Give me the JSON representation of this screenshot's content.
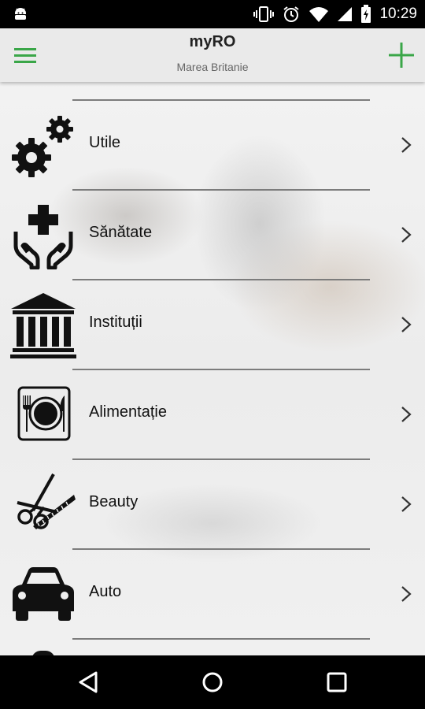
{
  "status_bar": {
    "time": "10:29"
  },
  "app_bar": {
    "title": "myRO",
    "subtitle": "Marea Britanie",
    "accent_color": "#3aa648"
  },
  "categories": [
    {
      "label": "Utile",
      "icon": "gears-icon"
    },
    {
      "label": "Sănătate",
      "icon": "health-hands-icon"
    },
    {
      "label": "Instituții",
      "icon": "institution-icon"
    },
    {
      "label": "Alimentație",
      "icon": "plate-cutlery-icon"
    },
    {
      "label": "Beauty",
      "icon": "scissors-comb-icon"
    },
    {
      "label": "Auto",
      "icon": "car-icon"
    }
  ]
}
